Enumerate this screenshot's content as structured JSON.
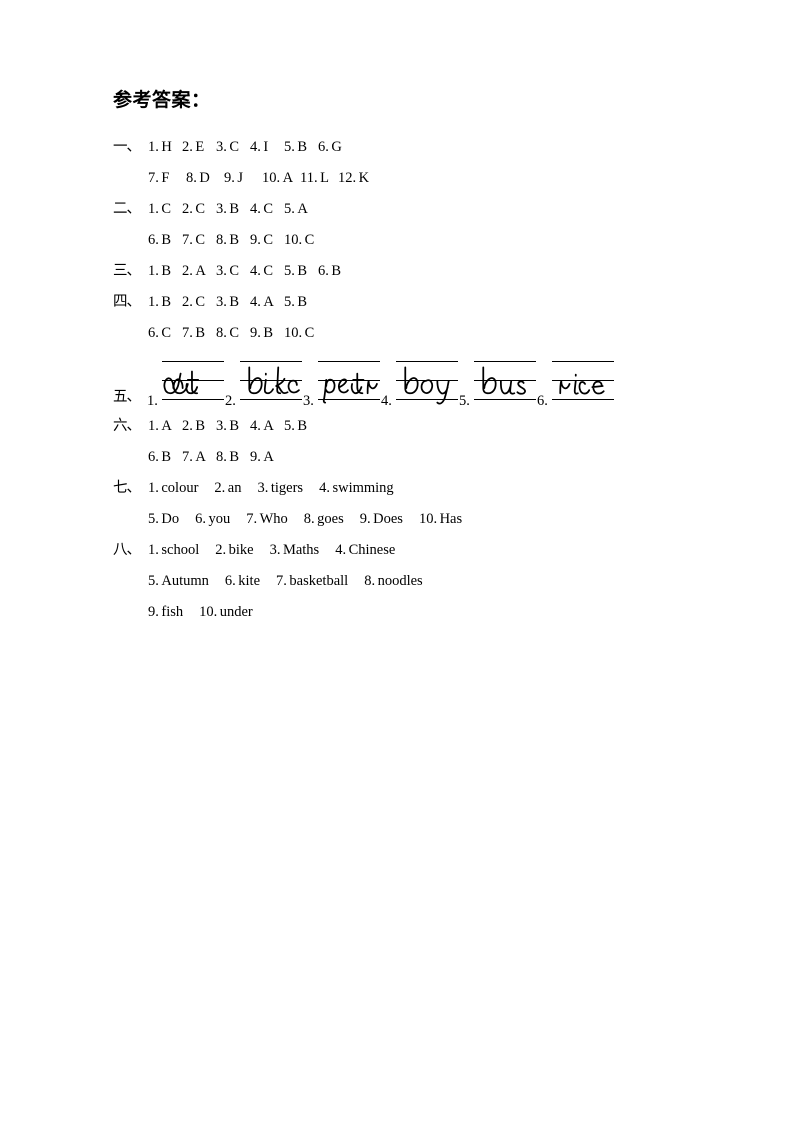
{
  "document": {
    "title": "参考答案："
  },
  "sections": [
    {
      "id": "section-1",
      "label": "一、",
      "type": "letters",
      "rows": [
        {
          "items": [
            {
              "num": "1.",
              "val": "H"
            },
            {
              "num": "2.",
              "val": "E"
            },
            {
              "num": "3.",
              "val": "C"
            },
            {
              "num": "4.",
              "val": "I"
            },
            {
              "num": "5.",
              "val": "B"
            },
            {
              "num": "6.",
              "val": "G"
            }
          ]
        },
        {
          "items": [
            {
              "num": "7.",
              "val": "F"
            },
            {
              "num": "8.",
              "val": "D"
            },
            {
              "num": "9.",
              "val": "J"
            },
            {
              "num": "10.",
              "val": "A"
            },
            {
              "num": "11.",
              "val": "L"
            },
            {
              "num": "12.",
              "val": "K"
            }
          ]
        }
      ]
    },
    {
      "id": "section-2",
      "label": "二、",
      "type": "letters",
      "rows": [
        {
          "items": [
            {
              "num": "1.",
              "val": "C"
            },
            {
              "num": "2.",
              "val": "C"
            },
            {
              "num": "3.",
              "val": "B"
            },
            {
              "num": "4.",
              "val": "C"
            },
            {
              "num": "5.",
              "val": "A"
            }
          ]
        },
        {
          "items": [
            {
              "num": "6.",
              "val": "B"
            },
            {
              "num": "7.",
              "val": "C"
            },
            {
              "num": "8.",
              "val": "B"
            },
            {
              "num": "9.",
              "val": "C"
            },
            {
              "num": "10.",
              "val": "C"
            }
          ]
        }
      ]
    },
    {
      "id": "section-3",
      "label": "三、",
      "type": "letters",
      "rows": [
        {
          "items": [
            {
              "num": "1.",
              "val": "B"
            },
            {
              "num": "2.",
              "val": "A"
            },
            {
              "num": "3.",
              "val": "C"
            },
            {
              "num": "4.",
              "val": "C"
            },
            {
              "num": "5.",
              "val": "B"
            },
            {
              "num": "6.",
              "val": "B"
            }
          ]
        }
      ]
    },
    {
      "id": "section-4",
      "label": "四、",
      "type": "letters",
      "rows": [
        {
          "items": [
            {
              "num": "1.",
              "val": "B"
            },
            {
              "num": "2.",
              "val": "C"
            },
            {
              "num": "3.",
              "val": "B"
            },
            {
              "num": "4.",
              "val": "A"
            },
            {
              "num": "5.",
              "val": "B"
            }
          ]
        },
        {
          "items": [
            {
              "num": "6.",
              "val": "C"
            },
            {
              "num": "7.",
              "val": "B"
            },
            {
              "num": "8.",
              "val": "C"
            },
            {
              "num": "9.",
              "val": "B"
            },
            {
              "num": "10.",
              "val": "C"
            }
          ]
        }
      ]
    },
    {
      "id": "section-6",
      "label": "六、",
      "type": "letters",
      "rows": [
        {
          "items": [
            {
              "num": "1.",
              "val": "A"
            },
            {
              "num": "2.",
              "val": "B"
            },
            {
              "num": "3.",
              "val": "B"
            },
            {
              "num": "4.",
              "val": "A"
            },
            {
              "num": "5.",
              "val": "B"
            }
          ]
        },
        {
          "items": [
            {
              "num": "6.",
              "val": "B"
            },
            {
              "num": "7.",
              "val": "A"
            },
            {
              "num": "8.",
              "val": "B"
            },
            {
              "num": "9.",
              "val": "A"
            }
          ]
        }
      ]
    },
    {
      "id": "section-7",
      "label": "七、",
      "type": "words",
      "rows": [
        {
          "items": [
            {
              "num": "1.",
              "val": "colour"
            },
            {
              "num": "2.",
              "val": "an"
            },
            {
              "num": "3.",
              "val": "tigers"
            },
            {
              "num": "4.",
              "val": "swimming"
            }
          ]
        },
        {
          "items": [
            {
              "num": "5.",
              "val": "Do"
            },
            {
              "num": "6.",
              "val": "you"
            },
            {
              "num": "7.",
              "val": "Who"
            },
            {
              "num": "8.",
              "val": "goes"
            },
            {
              "num": "9.",
              "val": "Does"
            },
            {
              "num": "10.",
              "val": "Has"
            }
          ]
        }
      ]
    },
    {
      "id": "section-8",
      "label": "八、",
      "type": "words",
      "rows": [
        {
          "items": [
            {
              "num": "1.",
              "val": "school"
            },
            {
              "num": "2.",
              "val": "bike"
            },
            {
              "num": "3.",
              "val": "Maths"
            },
            {
              "num": "4.",
              "val": "Chinese"
            }
          ]
        },
        {
          "items": [
            {
              "num": "5.",
              "val": "Autumn"
            },
            {
              "num": "6.",
              "val": "kite"
            },
            {
              "num": "7.",
              "val": "basketball"
            },
            {
              "num": "8.",
              "val": "noodles"
            }
          ]
        },
        {
          "items": [
            {
              "num": "9.",
              "val": "fish"
            },
            {
              "num": "10.",
              "val": "under"
            }
          ]
        }
      ]
    }
  ],
  "handwriting_section": {
    "id": "section-5",
    "label": "五、",
    "slots": [
      {
        "num": "1.",
        "word": "cat"
      },
      {
        "num": "2.",
        "word": "bike"
      },
      {
        "num": "3.",
        "word": "pear"
      },
      {
        "num": "4.",
        "word": "boy"
      },
      {
        "num": "5.",
        "word": "bus"
      },
      {
        "num": "6.",
        "word": "rice"
      }
    ]
  }
}
